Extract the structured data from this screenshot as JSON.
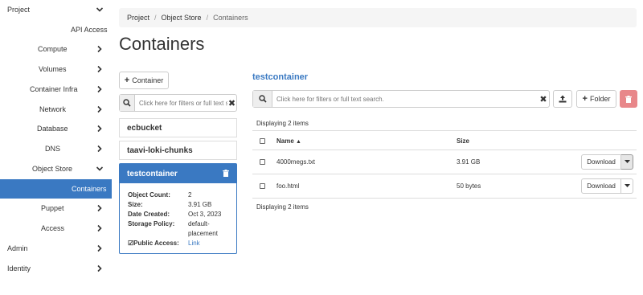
{
  "sidebar": {
    "project": "Project",
    "api_access": "API Access",
    "compute": "Compute",
    "volumes": "Volumes",
    "container_infra": "Container Infra",
    "network": "Network",
    "database": "Database",
    "dns": "DNS",
    "object_store": "Object Store",
    "containers": "Containers",
    "puppet": "Puppet",
    "access": "Access",
    "admin": "Admin",
    "identity": "Identity"
  },
  "breadcrumb": {
    "project": "Project",
    "object_store": "Object Store",
    "current": "Containers",
    "separator": "/"
  },
  "page_title": "Containers",
  "left": {
    "add_container": "Container",
    "search_placeholder": "Click here for filters or full text search.",
    "containers": [
      "ecbucket",
      "taavi-loki-chunks"
    ],
    "selected": {
      "name": "testcontainer",
      "object_count_label": "Object Count:",
      "object_count": "2",
      "size_label": "Size:",
      "size": "3.91 GB",
      "date_created_label": "Date Created:",
      "date_created": "Oct 3, 2023",
      "storage_policy_label": "Storage Policy:",
      "storage_policy_line1": "default-",
      "storage_policy_line2": "placement",
      "public_access_label": "Public Access:",
      "public_access_value": "Link"
    }
  },
  "right": {
    "title": "testcontainer",
    "search_placeholder": "Click here for filters or full text search.",
    "folder_btn": "Folder",
    "displaying_top": "Displaying 2 items",
    "displaying_bottom": "Displaying 2 items",
    "columns": {
      "name": "Name",
      "size": "Size"
    },
    "rows": [
      {
        "name": "4000megs.txt",
        "size": "3.91 GB",
        "action": "Download"
      },
      {
        "name": "foo.html",
        "size": "50 bytes",
        "action": "Download"
      }
    ]
  },
  "icons": {
    "chevron_down": "chevron-down-icon",
    "chevron_right": "chevron-right-icon",
    "search": "search-icon",
    "clear": "close-icon",
    "trash": "trash-icon",
    "upload": "upload-icon",
    "caret_down": "caret-down-icon",
    "sort_up": "sort-up-icon",
    "plus": "plus-icon"
  },
  "colors": {
    "accent": "#3a79c2",
    "danger": "#e8878a",
    "breadcrumb_bg": "#f5f5f5"
  }
}
